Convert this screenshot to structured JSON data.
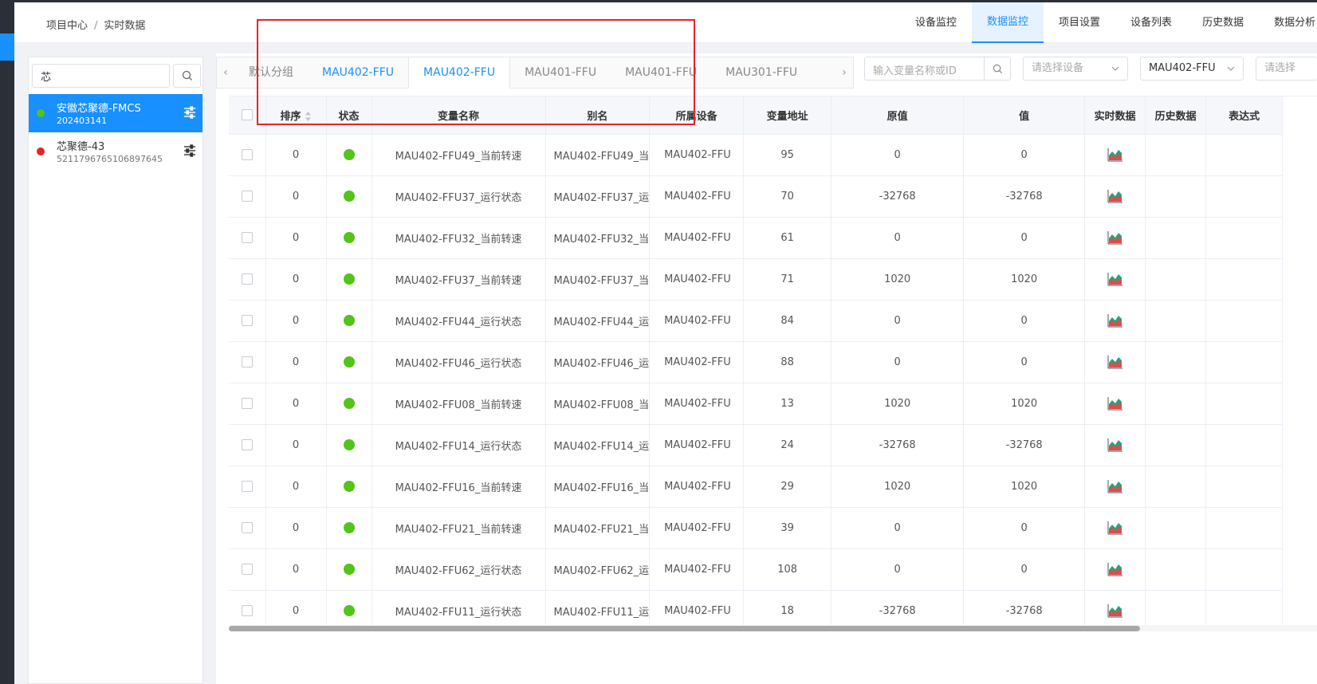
{
  "breadcrumb": {
    "root": "项目中心",
    "separator": "/",
    "current": "实时数据"
  },
  "topnav": [
    {
      "label": "设备监控",
      "active": false
    },
    {
      "label": "数据监控",
      "active": true
    },
    {
      "label": "项目设置",
      "active": false
    },
    {
      "label": "设备列表",
      "active": false
    },
    {
      "label": "历史数据",
      "active": false
    },
    {
      "label": "数据分析",
      "active": false
    }
  ],
  "project_search": {
    "value": "芯"
  },
  "projects": [
    {
      "name": "安徽芯聚德-FMCS",
      "code": "202403141",
      "status_color": "#52c41a",
      "active": true
    },
    {
      "name": "芯聚德-43",
      "code": "5211796765106897645",
      "status_color": "#e8212a",
      "active": false
    }
  ],
  "tabs": [
    {
      "label": "默认分组",
      "active": false
    },
    {
      "label": "MAU402-FFU",
      "active": false,
      "highlight": true
    },
    {
      "label": "MAU402-FFU",
      "active": true
    },
    {
      "label": "MAU401-FFU",
      "active": false
    },
    {
      "label": "MAU401-FFU",
      "active": false
    },
    {
      "label": "MAU301-FFU",
      "active": false
    }
  ],
  "filters": {
    "var_search_placeholder": "输入变量名称或ID",
    "device_select_placeholder": "请选择设备",
    "group_select_value": "MAU402-FFU",
    "extra_select_placeholder": "请选择"
  },
  "table": {
    "headers": [
      "",
      "排序",
      "状态",
      "变量名称",
      "别名",
      "所属设备",
      "变量地址",
      "原值",
      "值",
      "实时数据",
      "历史数据",
      "表达式"
    ],
    "rows": [
      {
        "order": "0",
        "name": "MAU402-FFU49_当前转速",
        "alias": "MAU402-FFU49_当",
        "device": "MAU402-FFU",
        "addr": "95",
        "raw": "0",
        "value": "0"
      },
      {
        "order": "0",
        "name": "MAU402-FFU37_运行状态",
        "alias": "MAU402-FFU37_运",
        "device": "MAU402-FFU",
        "addr": "70",
        "raw": "-32768",
        "value": "-32768"
      },
      {
        "order": "0",
        "name": "MAU402-FFU32_当前转速",
        "alias": "MAU402-FFU32_当",
        "device": "MAU402-FFU",
        "addr": "61",
        "raw": "0",
        "value": "0"
      },
      {
        "order": "0",
        "name": "MAU402-FFU37_当前转速",
        "alias": "MAU402-FFU37_当",
        "device": "MAU402-FFU",
        "addr": "71",
        "raw": "1020",
        "value": "1020"
      },
      {
        "order": "0",
        "name": "MAU402-FFU44_运行状态",
        "alias": "MAU402-FFU44_运",
        "device": "MAU402-FFU",
        "addr": "84",
        "raw": "0",
        "value": "0"
      },
      {
        "order": "0",
        "name": "MAU402-FFU46_运行状态",
        "alias": "MAU402-FFU46_运",
        "device": "MAU402-FFU",
        "addr": "88",
        "raw": "0",
        "value": "0"
      },
      {
        "order": "0",
        "name": "MAU402-FFU08_当前转速",
        "alias": "MAU402-FFU08_当",
        "device": "MAU402-FFU",
        "addr": "13",
        "raw": "1020",
        "value": "1020"
      },
      {
        "order": "0",
        "name": "MAU402-FFU14_运行状态",
        "alias": "MAU402-FFU14_运",
        "device": "MAU402-FFU",
        "addr": "24",
        "raw": "-32768",
        "value": "-32768"
      },
      {
        "order": "0",
        "name": "MAU402-FFU16_当前转速",
        "alias": "MAU402-FFU16_当",
        "device": "MAU402-FFU",
        "addr": "29",
        "raw": "1020",
        "value": "1020"
      },
      {
        "order": "0",
        "name": "MAU402-FFU21_当前转速",
        "alias": "MAU402-FFU21_当",
        "device": "MAU402-FFU",
        "addr": "39",
        "raw": "0",
        "value": "0"
      },
      {
        "order": "0",
        "name": "MAU402-FFU62_运行状态",
        "alias": "MAU402-FFU62_运",
        "device": "MAU402-FFU",
        "addr": "108",
        "raw": "0",
        "value": "0"
      },
      {
        "order": "0",
        "name": "MAU402-FFU11_运行状态",
        "alias": "MAU402-FFU11_运",
        "device": "MAU402-FFU",
        "addr": "18",
        "raw": "-32768",
        "value": "-32768"
      }
    ]
  },
  "colors": {
    "accent": "#1890ff",
    "online": "#52c41a",
    "offline": "#e8212a",
    "annotation": "#e8212a"
  }
}
